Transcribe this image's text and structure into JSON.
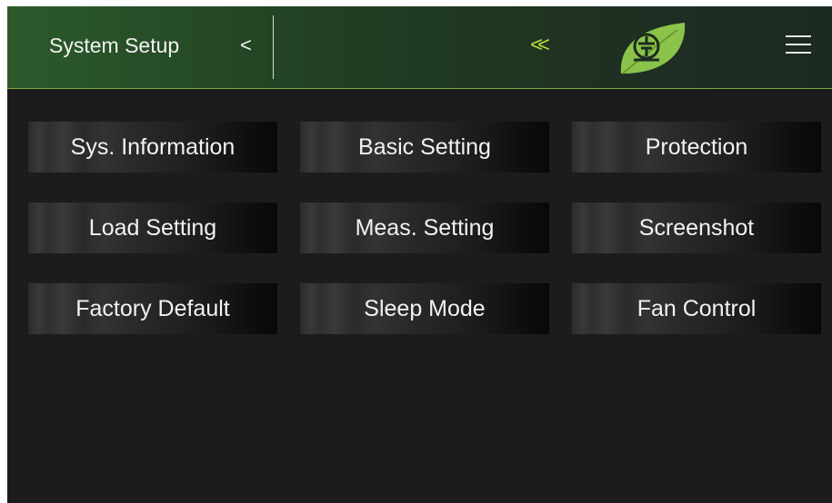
{
  "header": {
    "title": "System Setup",
    "back_glyph": "<",
    "collapse_glyph": "<<",
    "logo_glyph": "⏚",
    "accent_color": "#b8d63a",
    "header_gradient_start": "#2c5a2c",
    "header_gradient_end": "#1d2a21",
    "background_color": "#1c1c1c"
  },
  "menu": {
    "icon": "hamburger-icon"
  },
  "buttons": [
    {
      "label": "Sys. Information"
    },
    {
      "label": "Basic Setting"
    },
    {
      "label": "Protection"
    },
    {
      "label": "Load Setting"
    },
    {
      "label": "Meas. Setting"
    },
    {
      "label": "Screenshot"
    },
    {
      "label": "Factory Default"
    },
    {
      "label": "Sleep Mode"
    },
    {
      "label": "Fan Control"
    }
  ]
}
